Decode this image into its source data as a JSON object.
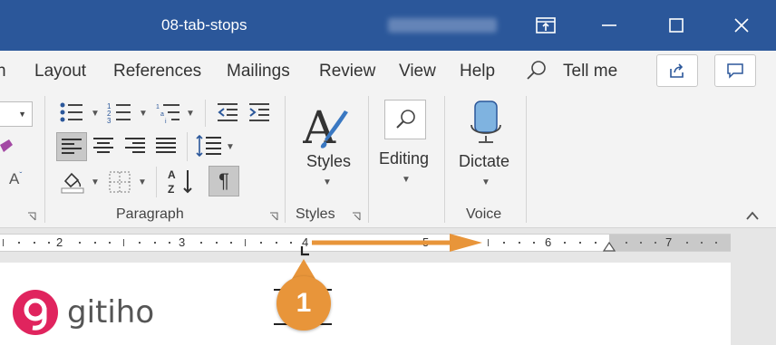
{
  "window": {
    "title": "08-tab-stops",
    "user_name_blurred": ""
  },
  "tabs": [
    {
      "label": "n"
    },
    {
      "label": "Layout"
    },
    {
      "label": "References"
    },
    {
      "label": "Mailings"
    },
    {
      "label": "Review"
    },
    {
      "label": "View"
    },
    {
      "label": "Help"
    },
    {
      "label": "Tell me"
    }
  ],
  "ribbon": {
    "groups": {
      "paragraph": "Paragraph",
      "styles": "Styles",
      "voice": "Voice"
    },
    "buttons": {
      "styles": "Styles",
      "editing": "Editing",
      "dictate": "Dictate"
    }
  },
  "ruler": {
    "numbers": [
      "2",
      "3",
      "4",
      "5",
      "6",
      "7"
    ]
  },
  "annotation": {
    "badge": "1"
  },
  "logo": {
    "name": "gitiho"
  },
  "colors": {
    "titlebar": "#2b579a",
    "badge": "#e8953a",
    "arrow": "#e8953a",
    "logo": "#e0245e"
  }
}
